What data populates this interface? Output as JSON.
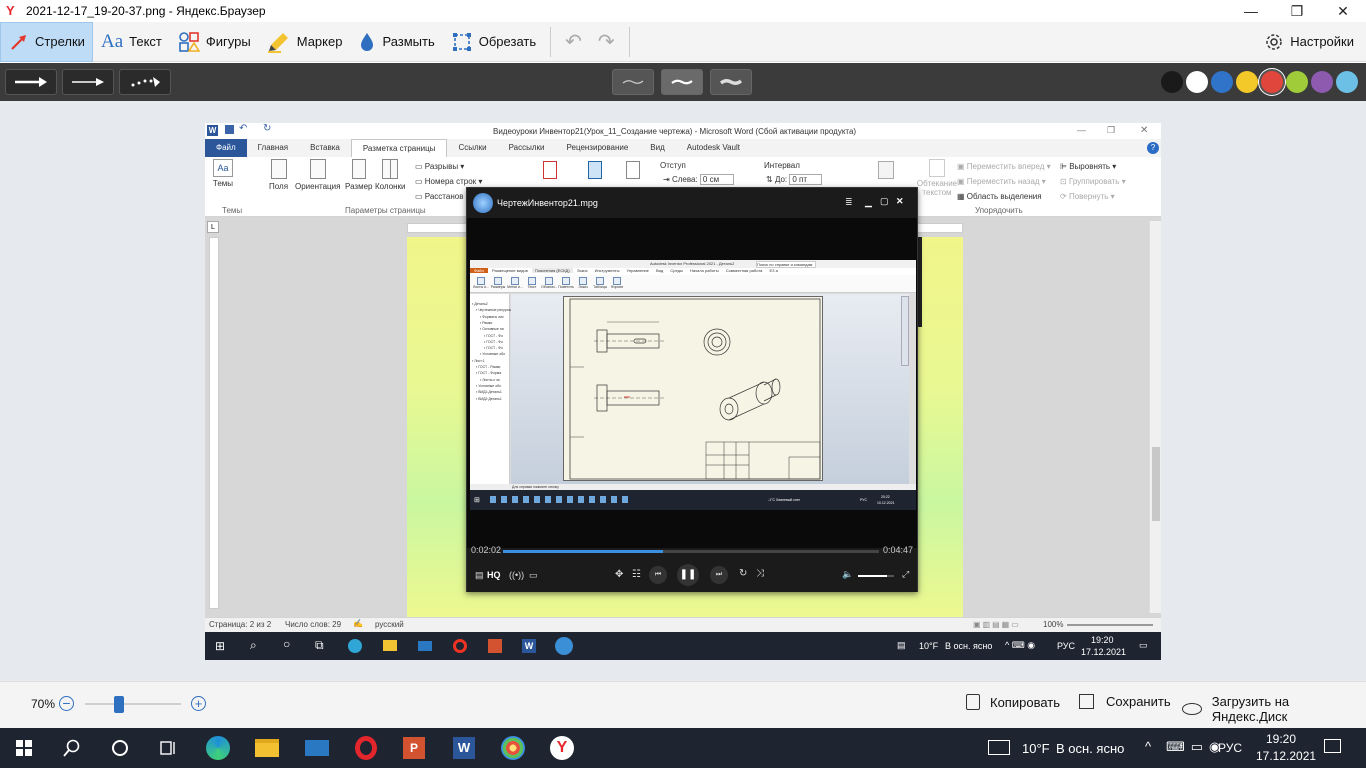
{
  "window": {
    "title": "2021-12-17_19-20-37.png - Яндекс.Браузер",
    "minimize": "—",
    "restore": "❐",
    "close": "✕"
  },
  "toolbar": {
    "tools": [
      {
        "label": "Стрелки",
        "icon": "arrow-icon",
        "active": true
      },
      {
        "label": "Текст",
        "icon": "text-icon"
      },
      {
        "label": "Фигуры",
        "icon": "shapes-icon"
      },
      {
        "label": "Маркер",
        "icon": "marker-icon"
      },
      {
        "label": "Размыть",
        "icon": "blur-icon"
      },
      {
        "label": "Обрезать",
        "icon": "crop-icon"
      }
    ],
    "settings_label": "Настройки",
    "colors": [
      "#1a1a1a",
      "#ffffff",
      "#2f74c8",
      "#f2c928",
      "#e0463c",
      "#a0cc3a",
      "#8d5ab0",
      "#6cc0e5"
    ]
  },
  "bottom": {
    "zoom": "70%",
    "zoom_level": 0.35,
    "copy_label": "Копировать",
    "save_label": "Сохранить",
    "upload_label": "Загрузить на Яндекс.Диск"
  },
  "taskbar": {
    "weather": "10°F",
    "weather_text": "В осн. ясно",
    "lang": "РУС",
    "time": "19:20",
    "date": "17.12.2021"
  },
  "word": {
    "title": "Видеоуроки Инвентор21(Урок_11_Создание чертежа)  -  Microsoft Word (Сбой активации продукта)",
    "tabs": [
      "Файл",
      "Главная",
      "Вставка",
      "Разметка страницы",
      "Ссылки",
      "Рассылки",
      "Рецензирование",
      "Вид",
      "Autodesk Vault"
    ],
    "ribbon": {
      "themes": "Темы",
      "fields": "Поля",
      "orientation": "Ориентация",
      "size": "Размер",
      "columns": "Колонки",
      "breaks": "Разрывы",
      "line_numbers": "Номера строк",
      "hyphenation": "Расстанов",
      "group_themes": "Темы",
      "group_page_setup": "Параметры страницы",
      "indent": "Отступ",
      "interval": "Интервал",
      "left": "Слева:",
      "left_val": "0 см",
      "before": "До:",
      "before_val": "0 пт",
      "wrap": "Обтекание текстом",
      "bring_forward": "Переместить вперед",
      "send_back": "Переместить назад",
      "selection_pane": "Область выделения",
      "align": "Выровнять",
      "group": "Группировать",
      "rotate": "Повернуть",
      "group_arrange": "Упорядочить"
    },
    "status": {
      "page": "Страница: 2 из 2",
      "words": "Число слов: 29",
      "lang": "русский",
      "zoom": "100%"
    },
    "taskbar": {
      "weather": "10°F",
      "weather_text": "В осн. ясно",
      "lang": "РУС",
      "time": "19:20",
      "date": "17.12.2021"
    }
  },
  "player": {
    "title": "ЧертежИнвентор21.mpg",
    "elapsed": "0:02:02",
    "total": "0:04:47",
    "progress": 0.425,
    "volume": 0.8,
    "hq": "HQ"
  },
  "inventor": {
    "title": "Autodesk Inventor Professional 2021 - Деталь2",
    "search": "Поиск по справке и командам",
    "tabs": [
      "Файл",
      "Размещение видов",
      "Пояснения (ЕСКД)",
      "Эскиз",
      "Инструменты",
      "Управление",
      "Вид",
      "Среды",
      "Начало работы",
      "Совместная работа",
      "ЕЗ а"
    ],
    "tools": [
      "Листы и...",
      "Размеры",
      "Метки и...",
      "Текст",
      "Обознач...",
      "Пометить",
      "Эскиз",
      "Таблица",
      "Формат"
    ],
    "tree": [
      "Деталь2",
      "Чертежные ресурсы",
      "Форматы лис",
      "Рамки",
      "Основные на",
      "ГОСТ - Фо",
      "ГОСТ - Фо",
      "ГОСТ - Фо",
      "Условные обо",
      "Лист:1",
      "ГОСТ - Рамки",
      "ГОСТ - Форма",
      "Листы к ча",
      "Условные обо",
      "ВИД1:Деталь1",
      "ВИД2:Деталь1"
    ],
    "status": "Для справки нажмите кнопку",
    "weather": "-1°C Ливневый снег",
    "time": "20:22",
    "date": "10.12.2021",
    "lang": "РУС"
  }
}
